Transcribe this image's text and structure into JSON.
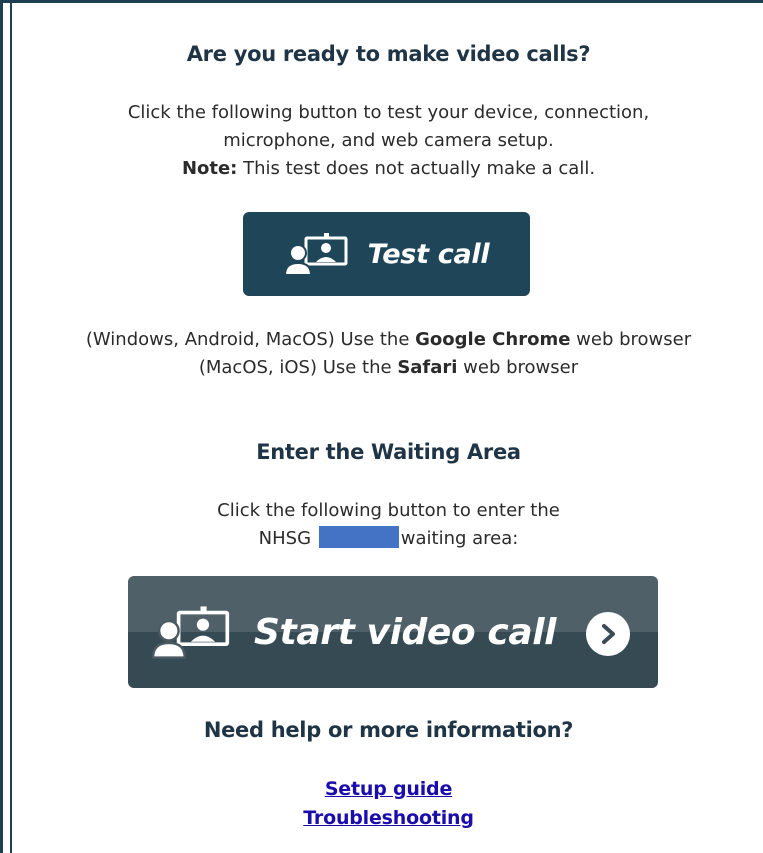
{
  "section1": {
    "title": "Are you ready to make video calls?",
    "desc_line1": "Click the following button to test your device, connection,",
    "desc_line2": "microphone, and web camera setup.",
    "note_label": "Note:",
    "note_text": " This test does not actually make a call."
  },
  "test_button": {
    "icon": "video-call-people-icon",
    "label": "Test call"
  },
  "browsers": {
    "line1_prefix": "(Windows, Android, MacOS) Use the ",
    "line1_browser": "Google Chrome",
    "line1_suffix": " web browser",
    "line2_prefix": "(MacOS, iOS) Use the ",
    "line2_browser": "Safari",
    "line2_suffix": " web browser"
  },
  "section2": {
    "title": "Enter the Waiting Area",
    "desc_line1": "Click the following button to enter the",
    "desc_line2_prefix": "NHSG",
    "desc_line2_suffix": "waiting area:"
  },
  "start_button": {
    "icon": "video-call-people-icon",
    "label": "Start video call",
    "arrow_icon": "chevron-right-circle-icon"
  },
  "help": {
    "title": "Need help or more information?",
    "links": [
      "Setup guide",
      "Troubleshooting"
    ]
  },
  "colors": {
    "test_button_bg": "#1f4559",
    "start_button_top": "#4f6069",
    "start_button_bottom": "#364a54",
    "link": "#1a0dab",
    "redaction": "#4472c4"
  }
}
